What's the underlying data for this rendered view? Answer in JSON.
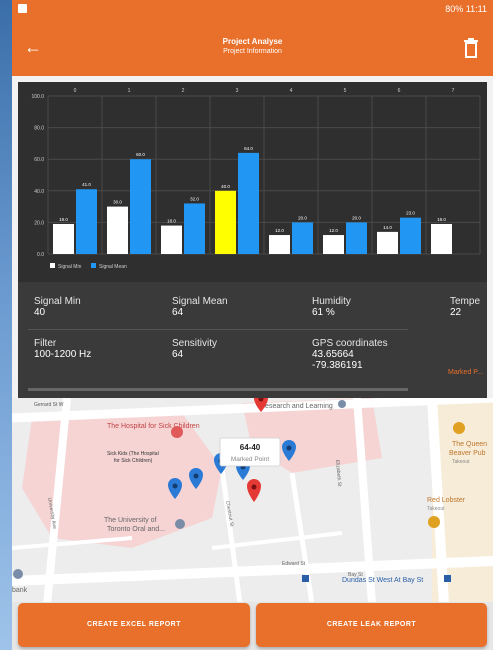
{
  "status": {
    "right": "80% 11:11"
  },
  "appbar": {
    "title": "Project Analyse",
    "subtitle": "Project Information"
  },
  "chart_data": {
    "type": "bar",
    "categories": [
      "0",
      "1",
      "2",
      "3",
      "4",
      "5",
      "6",
      "7"
    ],
    "series": [
      {
        "name": "Signal Min",
        "values": [
          19.0,
          30.0,
          18.0,
          40.0,
          12.0,
          12.0,
          14.0,
          19.0
        ],
        "labels": [
          "19.0",
          "30.0",
          "18.0",
          "40.0",
          "12.0",
          "12.0",
          "14.0",
          "19.0"
        ]
      },
      {
        "name": "Signal Mean",
        "values": [
          41.0,
          60.0,
          32.0,
          64.0,
          20.0,
          20.0,
          23.0,
          null
        ],
        "labels": [
          "41.0",
          "60.0",
          "32.0",
          "64.0",
          "20.0",
          "20.0",
          "23.0",
          ""
        ]
      }
    ],
    "highlight_index": 3,
    "ylim": [
      0,
      100
    ],
    "yticks": [
      "0.0",
      "20.0",
      "40.0",
      "60.0",
      "80.0",
      "100.0"
    ],
    "grid": true,
    "legend_position": "bottom-left",
    "colors": {
      "min": "#ffffff",
      "mean": "#2196f3",
      "highlight": "#ffff00",
      "background": "#2f2f2f",
      "grid": "#4a4a4a",
      "text": "#cfcfcf"
    }
  },
  "info": {
    "signal_min": {
      "label": "Signal Min",
      "value": "40"
    },
    "signal_mean": {
      "label": "Signal Mean",
      "value": "64"
    },
    "humidity": {
      "label": "Humidity",
      "value": "61 %"
    },
    "temp": {
      "label": "Tempe",
      "value": "22"
    },
    "filter": {
      "label": "Filter",
      "value": "100-1200 Hz"
    },
    "sensitivity": {
      "label": "Sensitivity",
      "value": "64"
    },
    "gps": {
      "label": "GPS coordinates",
      "lat": "43.65664",
      "lon": "-79.386191"
    },
    "marked": "Marked P..."
  },
  "map": {
    "callout_title": "64-40",
    "callout_sub": "Marked Point",
    "labels": {
      "hospital": "The Hospital for Sick Children",
      "sickkids_line1": "Sick Kids (The Hospital",
      "sickkids_line2": "for Sick Children)",
      "research": "Research and Learning",
      "uoft_line1": "The University of",
      "uoft_line2": "Toronto Oral and...",
      "queen_line1": "The Queen",
      "queen_line2": "Beaver Pub",
      "queen_sub": "Takeout",
      "redlobster": "Red Lobster",
      "redlobster_sub": "Takeout",
      "dundas": "Dundas St West At Bay St",
      "bank": "bank",
      "gerrard": "Gerrard St W",
      "elizabeth": "Elizabeth St",
      "university": "University Ave",
      "chestnut": "Chestnut St",
      "edward": "Edward St",
      "bay": "Bay St"
    }
  },
  "buttons": {
    "excel": "CREATE EXCEL REPORT",
    "leak": "CREATE LEAK REPORT"
  }
}
